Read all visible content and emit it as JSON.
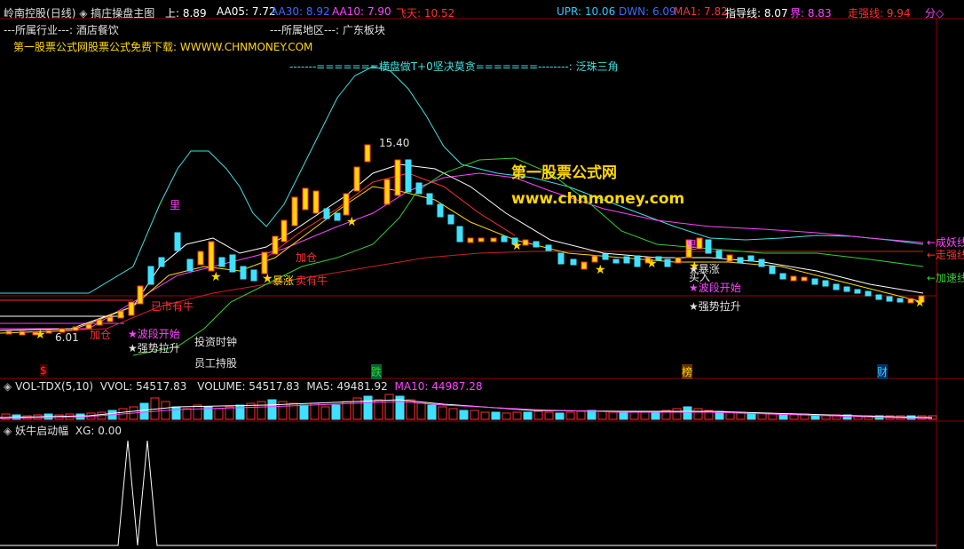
{
  "header": {
    "stock_name": "岭南控股",
    "period": "(日线)",
    "indicator_name": "搞庄操盘主图",
    "items": [
      {
        "label": "上: 8.89",
        "color": "#ffffff"
      },
      {
        "label": "AA05: 7.72",
        "color": "#ffffff"
      },
      {
        "label": "AA30: 8.92",
        "color": "#3a6cff"
      },
      {
        "label": "AA10: 7.90",
        "color": "#ff44ff"
      },
      {
        "label": "飞天: 10.52",
        "color": "#ff3030"
      },
      {
        "label": "UPR: 10.06",
        "color": "#30c8ff"
      },
      {
        "label": "DWN: 6.09",
        "color": "#3a6cff"
      },
      {
        "label": "MA1: 7.82",
        "color": "#ff3030"
      },
      {
        "label": "指导线: 8.07",
        "color": "#ffffff"
      },
      {
        "label": "界: 8.83",
        "color": "#ff44ff"
      },
      {
        "label": "走强线: 9.94",
        "color": "#ff3030"
      }
    ],
    "right_label": "分◇"
  },
  "info": {
    "industry": "---所属行业---: 酒店餐饮",
    "region": "---所属地区---: 广东板块",
    "website_line": "第一股票公式网股票公式免费下载: WWWW.CHNMONEY.COM",
    "banner": "-------=======横盘做T+0坚决莫贪=======--------: 泛珠三角"
  },
  "watermark": {
    "line1": "第一股票公式网",
    "line2": "www.chnmoney.com"
  },
  "annotations": {
    "price_high": "15.40",
    "price_low": "6.01",
    "li": "里",
    "li2": "里",
    "bull_market": "已市有牛",
    "wave_start1": "★波段开始",
    "strong_pull1": "★强势拉升",
    "invest_time": "投资时钟",
    "staff_hold": "员工持股",
    "add_position": "加仓",
    "surge1": "暴涨",
    "sell_bull": "卖有牛",
    "surge2": "★暴涨",
    "buy_in": "买入",
    "wave_start2": "★波段开始",
    "strong_pull2": "★强势拉升",
    "add_small": "加仓",
    "right_label1": "←成妖线",
    "right_label2": "←走强线",
    "right_label3": "←加速线",
    "bottom_s": "$",
    "bottom_die": "跌",
    "bottom_bang": "榜",
    "bottom_cai": "财"
  },
  "volume_panel": {
    "title": "VOL-TDX(5,10)",
    "vvol": "VVOL: 54517.83",
    "volume": "VOLUME: 54517.83",
    "ma5": "MA5: 49481.92",
    "ma10": "MA10: 44987.28"
  },
  "sub_panel": {
    "title": "妖牛启动幅",
    "xg": "XG: 0.00"
  },
  "colors": {
    "up": "#ff3030",
    "down": "#40e0ff",
    "yellow": "#ffd700",
    "cyan": "#40e0e0",
    "magenta": "#ff44ff",
    "green": "#30d030",
    "grid": "#8b0000"
  }
}
